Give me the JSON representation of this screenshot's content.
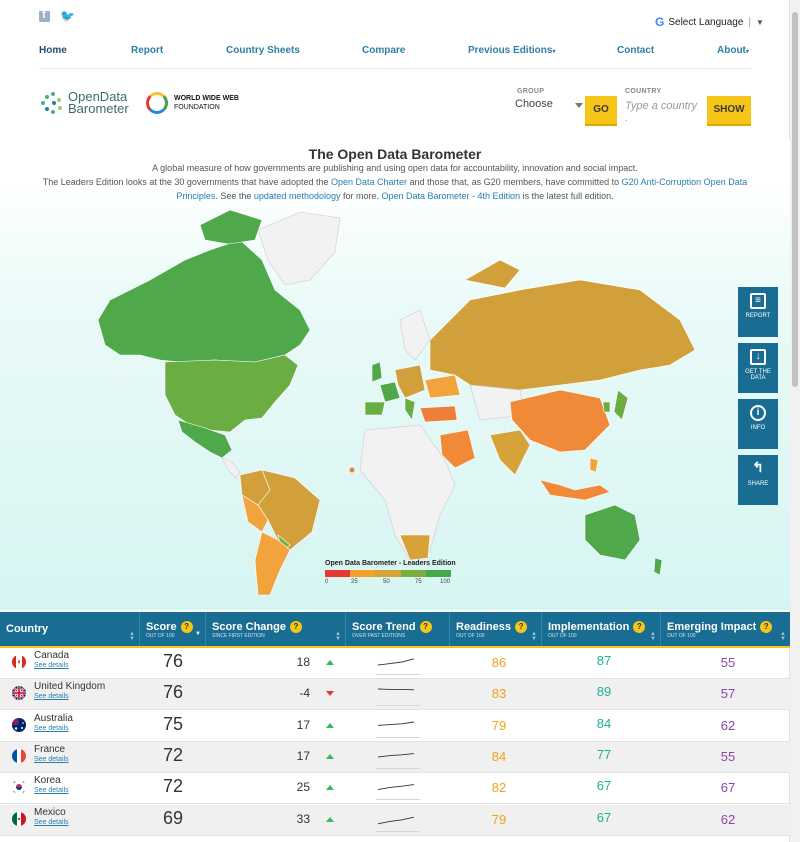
{
  "nav": {
    "home": "Home",
    "report": "Report",
    "country_sheets": "Country Sheets",
    "compare": "Compare",
    "previous": "Previous Editions",
    "contact": "Contact",
    "about": "About"
  },
  "language": {
    "label": "Select Language"
  },
  "logos": {
    "odb_line1": "OpenData",
    "odb_line2": "Barometer",
    "www_line1": "WORLD WIDE WEB",
    "www_line2": "FOUNDATION"
  },
  "selectors": {
    "group_label": "GROUP",
    "group_value": "Choose",
    "go": "GO",
    "country_label": "COUNTRY",
    "country_placeholder": "Type a country .",
    "show": "SHOW"
  },
  "hero": {
    "title": "The Open Data Barometer",
    "line1": "A global measure of how governments are publishing and using open data for accountability, innovation and social impact.",
    "p2a": "The Leaders Edition looks at the 30 governments that have adopted the ",
    "p2_link1": "Open Data Charter",
    "p2b": " and those that, as G20 members, have committed to ",
    "p2_link2": "G20 Anti-Corruption Open Data Principles",
    "p2c": ". See the ",
    "p2_link3": "updated methodology",
    "p2d": " for more. ",
    "p2_link4": "Open Data Barometer - 4th Edition",
    "p2e": " is the latest full edition."
  },
  "side_buttons": [
    "REPORT",
    "GET THE DATA",
    "INFO",
    "SHARE"
  ],
  "legend": {
    "title": "Open Data Barometer - Leaders Edition",
    "ticks": [
      "0",
      "25",
      "50",
      "75",
      "100"
    ],
    "colors": [
      "#e53935",
      "#f4a02a",
      "#d4a43a",
      "#7cae3f",
      "#45a84a"
    ]
  },
  "table": {
    "headers": [
      {
        "title": "Country",
        "sub": ""
      },
      {
        "title": "Score",
        "sub": "OUT OF 100"
      },
      {
        "title": "Score Change",
        "sub": "SINCE FIRST EDITION"
      },
      {
        "title": "Score Trend",
        "sub": "OVER PAST EDITIONS"
      },
      {
        "title": "Readiness",
        "sub": "OUT OF 100"
      },
      {
        "title": "Implementation",
        "sub": "OUT OF 100"
      },
      {
        "title": "Emerging Impact",
        "sub": "OUT OF 100"
      }
    ],
    "see_details": "See details",
    "rows": [
      {
        "country": "Canada",
        "score": "76",
        "change": "18",
        "dir": "up",
        "readiness": "86",
        "implementation": "87",
        "impact": "55",
        "flag": "canada",
        "trend": [
          45,
          52,
          60,
          76
        ]
      },
      {
        "country": "United Kingdom",
        "score": "76",
        "change": "-4",
        "dir": "down",
        "readiness": "83",
        "implementation": "89",
        "impact": "57",
        "flag": "uk",
        "trend": [
          80,
          78,
          78,
          76
        ]
      },
      {
        "country": "Australia",
        "score": "75",
        "change": "17",
        "dir": "up",
        "readiness": "79",
        "implementation": "84",
        "impact": "62",
        "flag": "australia",
        "trend": [
          58,
          62,
          66,
          75
        ]
      },
      {
        "country": "France",
        "score": "72",
        "change": "17",
        "dir": "up",
        "readiness": "84",
        "implementation": "77",
        "impact": "55",
        "flag": "france",
        "trend": [
          55,
          62,
          66,
          72
        ]
      },
      {
        "country": "Korea",
        "score": "72",
        "change": "25",
        "dir": "up",
        "readiness": "82",
        "implementation": "67",
        "impact": "67",
        "flag": "korea",
        "trend": [
          47,
          58,
          64,
          72
        ]
      },
      {
        "country": "Mexico",
        "score": "69",
        "change": "33",
        "dir": "up",
        "readiness": "79",
        "implementation": "67",
        "impact": "62",
        "flag": "mexico",
        "trend": [
          36,
          48,
          56,
          69
        ]
      }
    ]
  }
}
